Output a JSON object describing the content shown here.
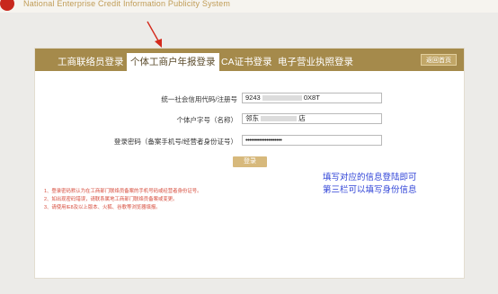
{
  "header": {
    "subtitle": "National Enterprise Credit Information Publicity System"
  },
  "tabs": [
    {
      "label": "工商联络员登录"
    },
    {
      "label": "个体工商户年报登录"
    },
    {
      "label": "CA证书登录"
    },
    {
      "label": "电子营业执照登录"
    }
  ],
  "return_button": "返回首页",
  "form": {
    "code": {
      "label": "统一社会信用代码/注册号",
      "prefix": "9243",
      "suffix": "0X8T"
    },
    "name": {
      "label": "个体户字号（名称）",
      "prefix": "邻东",
      "suffix": "店"
    },
    "password": {
      "label": "登录密码（备案手机号/经营者身份证号）",
      "value": "•••••••••••••••••••"
    },
    "submit": "登录"
  },
  "annotation": {
    "line1": "填写对应的信息登陆即可",
    "line2": "第三栏可以填写身份信息"
  },
  "notes": [
    "1、登录密码默认为在工商部门联络员备案的手机号码或经营者身份证号。",
    "2、如出现密码错误，请联系属地工商部门联络员备案或变更。",
    "3、请使用IE8及以上版本、火狐、谷歌等浏览器填报。"
  ],
  "colors": {
    "tabbar": "#a58a4b",
    "annotation": "#2f43d7",
    "notes": "#d64a3a",
    "arrow": "#d42a1c"
  }
}
